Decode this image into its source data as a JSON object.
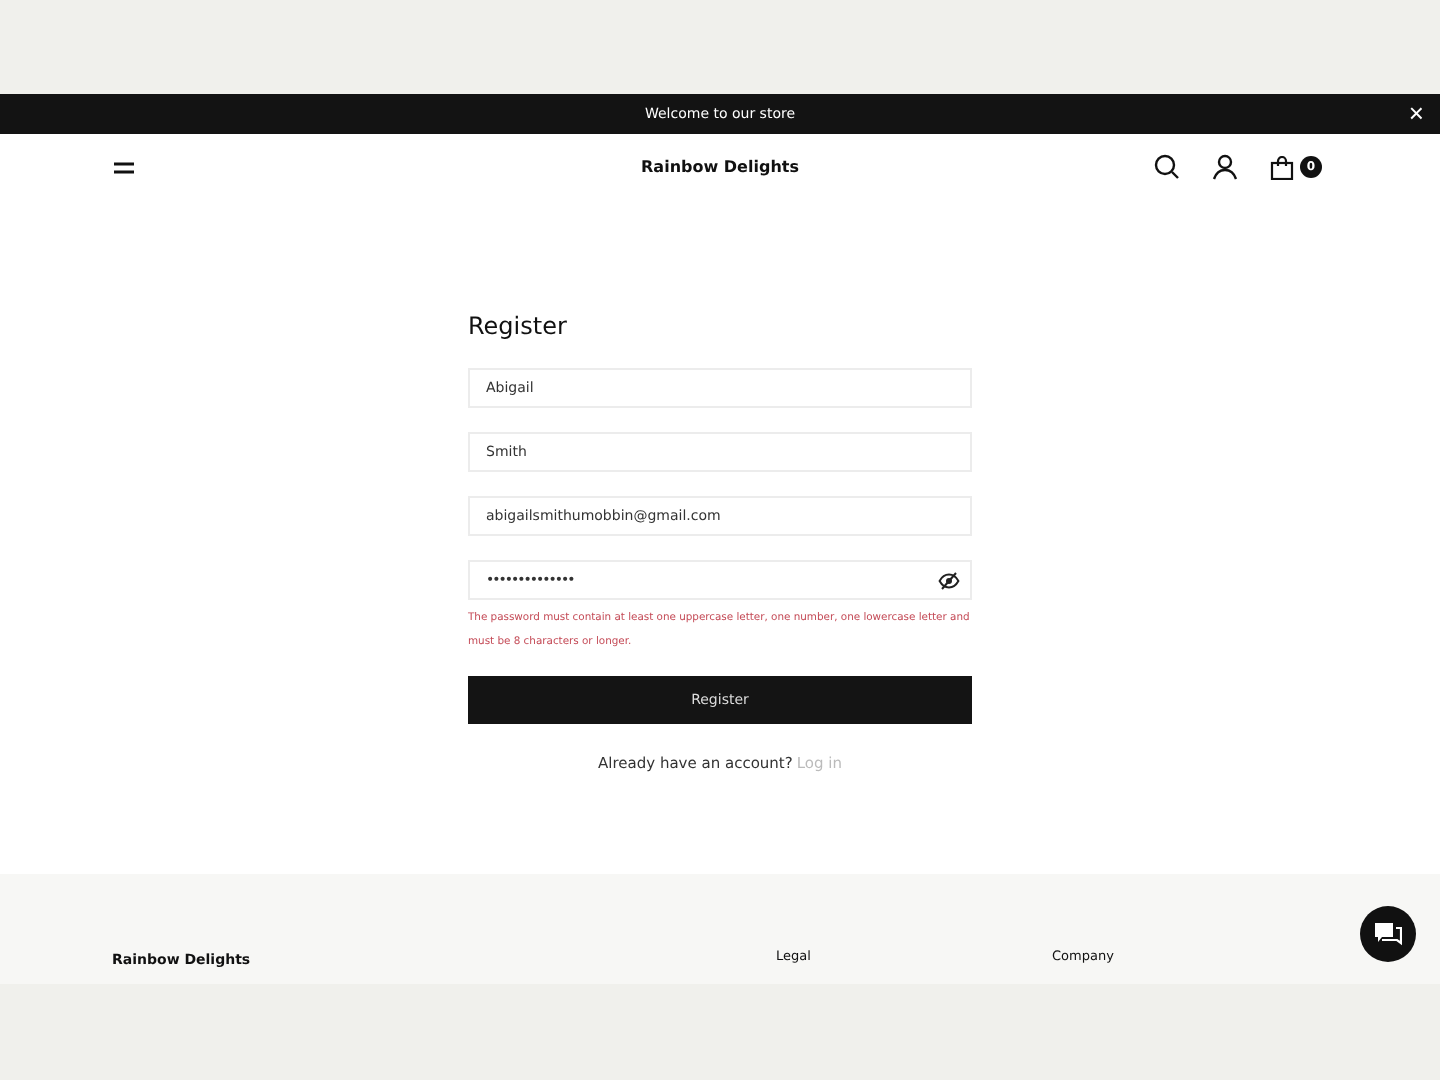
{
  "announcement": {
    "text": "Welcome to our store",
    "close": "×"
  },
  "header": {
    "brand": "Rainbow Delights",
    "cart_count": "0"
  },
  "form": {
    "title": "Register",
    "fields": [
      {
        "kind": "text",
        "value": "Abigail"
      },
      {
        "kind": "text",
        "value": "Smith"
      },
      {
        "kind": "text",
        "value": "abigailsmithumobbin@gmail.com"
      },
      {
        "kind": "password",
        "value": "••••••••••••••"
      }
    ],
    "error": "The password must contain at least one uppercase letter, one number, one lowercase letter and must be 8 characters or longer.",
    "submit": "Register",
    "login_prompt": "Already have an account?",
    "login_link": "Log in"
  },
  "footer": {
    "brand": "Rainbow Delights",
    "columns": [
      "Legal",
      "Company"
    ]
  }
}
